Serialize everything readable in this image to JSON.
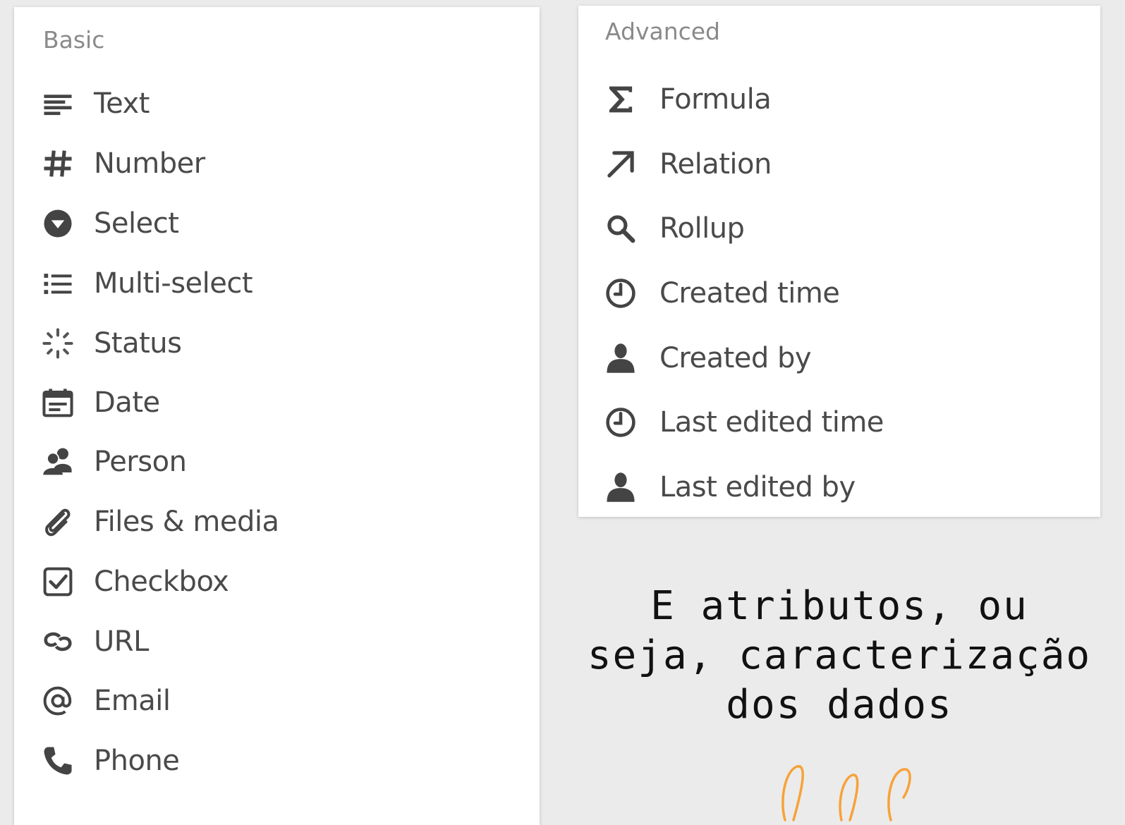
{
  "basic": {
    "heading": "Basic",
    "items": [
      {
        "label": "Text",
        "icon": "text-lines-icon"
      },
      {
        "label": "Number",
        "icon": "hash-icon"
      },
      {
        "label": "Select",
        "icon": "select-circle-icon"
      },
      {
        "label": "Multi-select",
        "icon": "list-icon"
      },
      {
        "label": "Status",
        "icon": "status-spinner-icon"
      },
      {
        "label": "Date",
        "icon": "calendar-icon"
      },
      {
        "label": "Person",
        "icon": "people-icon"
      },
      {
        "label": "Files & media",
        "icon": "paperclip-icon"
      },
      {
        "label": "Checkbox",
        "icon": "checkbox-icon"
      },
      {
        "label": "URL",
        "icon": "link-icon"
      },
      {
        "label": "Email",
        "icon": "at-icon"
      },
      {
        "label": "Phone",
        "icon": "phone-icon"
      }
    ]
  },
  "advanced": {
    "heading": "Advanced",
    "items": [
      {
        "label": "Formula",
        "icon": "sigma-icon"
      },
      {
        "label": "Relation",
        "icon": "arrow-up-right-icon"
      },
      {
        "label": "Rollup",
        "icon": "search-icon"
      },
      {
        "label": "Created time",
        "icon": "clock-icon"
      },
      {
        "label": "Created by",
        "icon": "person-icon"
      },
      {
        "label": "Last edited time",
        "icon": "clock-icon"
      },
      {
        "label": "Last edited by",
        "icon": "person-icon"
      }
    ]
  },
  "caption": {
    "line1": "E atributos, ou",
    "line2": "seja, caracterização",
    "line3": "dos dados"
  },
  "colors": {
    "background": "#ebebeb",
    "panel": "#ffffff",
    "icon": "#444444",
    "label": "#4a4a4a",
    "heading": "#8a8a8a",
    "accent_orange": "#f7a23a"
  }
}
